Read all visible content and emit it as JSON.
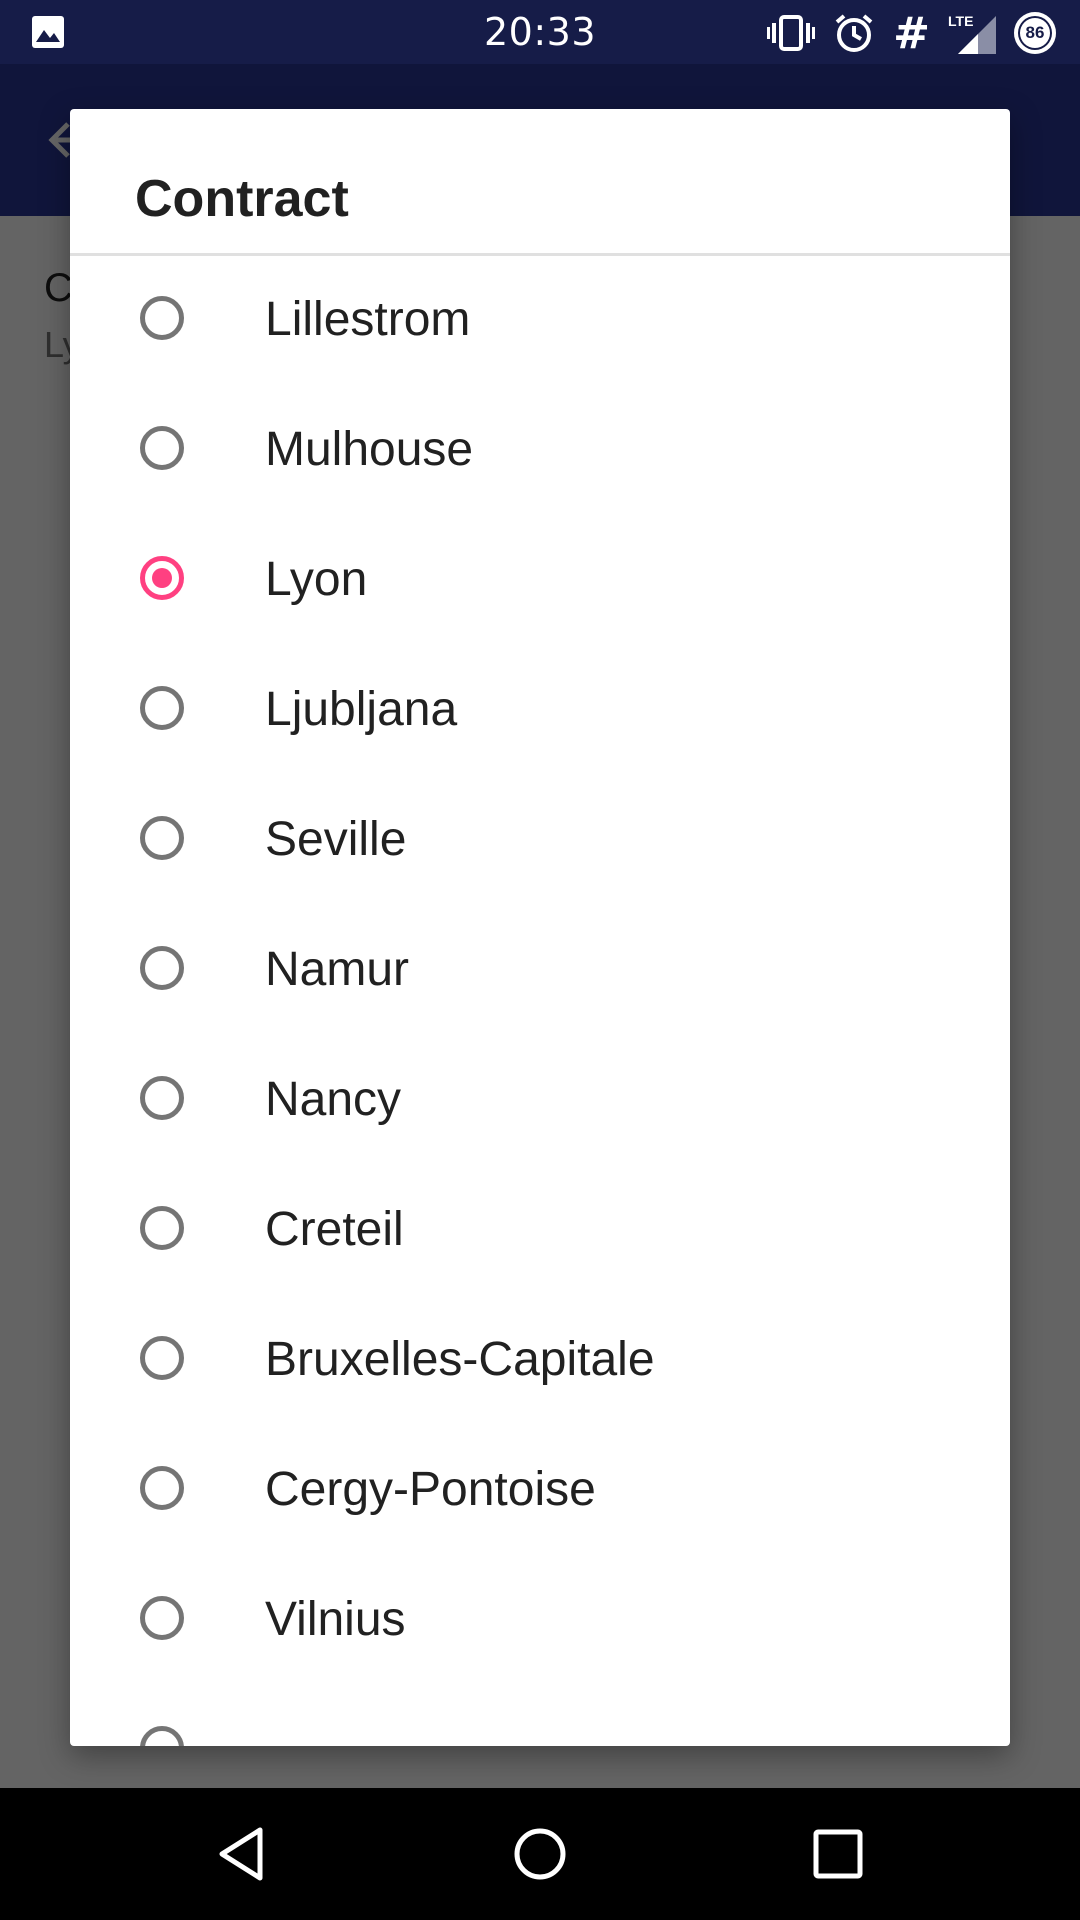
{
  "status_bar": {
    "time": "20:33",
    "network_label": "LTE",
    "battery_level": "86",
    "icons": [
      "gallery-icon",
      "vibrate-icon",
      "alarm-icon",
      "hash-icon",
      "signal-icon",
      "battery-icon"
    ]
  },
  "background": {
    "title_partial": "C",
    "subtitle_partial": "Ly"
  },
  "dialog": {
    "title": "Contract",
    "selected_index": 2,
    "options": [
      {
        "label": "Lillestrom",
        "selected": false
      },
      {
        "label": "Mulhouse",
        "selected": false
      },
      {
        "label": "Lyon",
        "selected": true
      },
      {
        "label": "Ljubljana",
        "selected": false
      },
      {
        "label": "Seville",
        "selected": false
      },
      {
        "label": "Namur",
        "selected": false
      },
      {
        "label": "Nancy",
        "selected": false
      },
      {
        "label": "Creteil",
        "selected": false
      },
      {
        "label": "Bruxelles-Capitale",
        "selected": false
      },
      {
        "label": "Cergy-Pontoise",
        "selected": false
      },
      {
        "label": "Vilnius",
        "selected": false
      },
      {
        "label": "",
        "selected": false
      }
    ]
  },
  "colors": {
    "status_bar": "#161c48",
    "app_bar": "#283593",
    "accent": "#ff4081",
    "radio_unchecked": "#757575"
  },
  "nav_bar": {
    "buttons": [
      "back-icon",
      "home-icon",
      "recents-icon"
    ]
  }
}
